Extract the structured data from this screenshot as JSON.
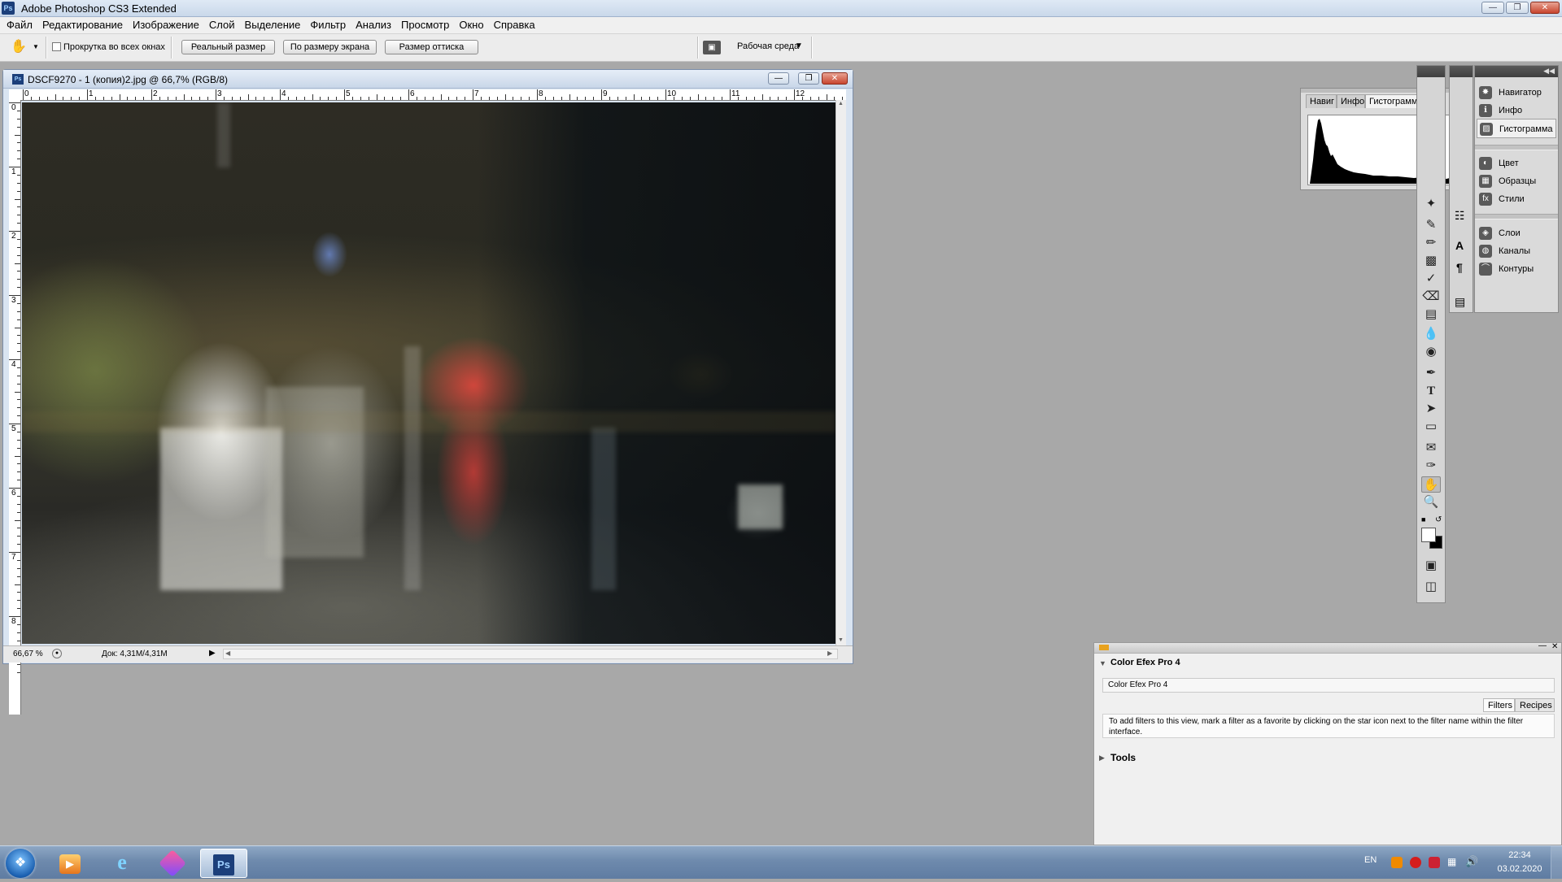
{
  "app": {
    "title": "Adobe Photoshop CS3 Extended",
    "icon_text": "Ps"
  },
  "menu": {
    "items": [
      "Файл",
      "Редактирование",
      "Изображение",
      "Слой",
      "Выделение",
      "Фильтр",
      "Анализ",
      "Просмотр",
      "Окно",
      "Справка"
    ]
  },
  "options": {
    "scroll_all_label": "Прокрутка во всех окнах",
    "actual_pixels": "Реальный размер",
    "fit_screen": "По размеру экрана",
    "print_size": "Размер оттиска",
    "workspace": "Рабочая среда"
  },
  "document": {
    "title": "DSCF9270 - 1 (копия)2.jpg @ 66,7% (RGB/8)",
    "icon_text": "Ps",
    "zoom": "66,67 %",
    "doc_size": "Док: 4,31M/4,31M",
    "ruler_top": [
      "0",
      "1",
      "2",
      "3",
      "4",
      "5",
      "6",
      "7",
      "8",
      "9",
      "10",
      "11",
      "12"
    ],
    "ruler_left": [
      "0",
      "1",
      "2",
      "3",
      "4",
      "5",
      "6",
      "7",
      "8"
    ]
  },
  "histogram_panel": {
    "tabs": [
      "Навиг",
      "Инфо",
      "Гистограмма"
    ]
  },
  "dock": {
    "items": [
      {
        "label": "Навигатор",
        "icon": "navigator-icon"
      },
      {
        "label": "Инфо",
        "icon": "info-icon"
      },
      {
        "label": "Гистограмма",
        "icon": "histogram-icon"
      },
      {
        "label": "Цвет",
        "icon": "color-icon"
      },
      {
        "label": "Образцы",
        "icon": "swatches-icon"
      },
      {
        "label": "Стили",
        "icon": "styles-icon"
      },
      {
        "label": "Слои",
        "icon": "layers-icon"
      },
      {
        "label": "Каналы",
        "icon": "channels-icon"
      },
      {
        "label": "Контуры",
        "icon": "paths-icon"
      }
    ]
  },
  "efex": {
    "header": "Color Efex Pro 4",
    "field": "Color Efex Pro 4",
    "tab_filters": "Filters",
    "tab_recipes": "Recipes",
    "info": "To add filters to this view, mark a filter as a favorite by clicking on the star icon next to the filter name within the filter interface.",
    "tools": "Tools"
  },
  "taskbar": {
    "lang": "EN",
    "time": "22:34",
    "date": "03.02.2020"
  }
}
